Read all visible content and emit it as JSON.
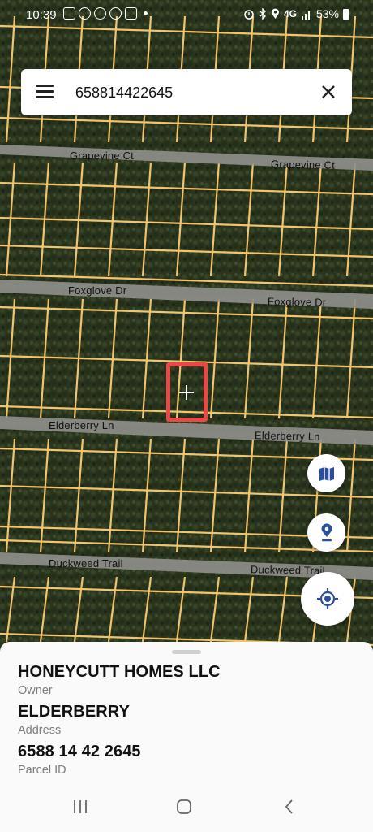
{
  "status_bar": {
    "time": "10:39",
    "network": "4G",
    "battery": "53%"
  },
  "search": {
    "value": "658814422645",
    "menu_icon": "menu-icon",
    "clear_icon": "close-icon"
  },
  "map": {
    "roads": [
      {
        "name": "Grapevine Ct",
        "labels": [
          "Grapevine Ct",
          "Grapevine Ct"
        ]
      },
      {
        "name": "Foxglove Dr",
        "labels": [
          "Foxglove Dr",
          "Foxglove Dr"
        ]
      },
      {
        "name": "Elderberry Ln",
        "labels": [
          "Elderberry Ln",
          "Elderberry Ln"
        ]
      },
      {
        "name": "Duckweed Trail",
        "labels": [
          "Duckweed Trail",
          "Duckweed Trail"
        ]
      }
    ],
    "highlight_color": "#e84848",
    "parcel_line_color": "#f2c46e"
  },
  "controls": {
    "layers_icon": "map-layers-icon",
    "pin_icon": "location-pin-icon",
    "locate_icon": "my-location-icon",
    "accent": "#2b4f9e"
  },
  "parcel": {
    "owner_value": "HONEYCUTT HOMES LLC",
    "owner_label": "Owner",
    "address_value": "ELDERBERRY",
    "address_label": "Address",
    "parcel_id_value": "6588 14 42 2645",
    "parcel_id_label": "Parcel ID"
  },
  "nav": {
    "recents_icon": "recents-icon",
    "home_icon": "home-icon",
    "back_icon": "back-icon"
  }
}
